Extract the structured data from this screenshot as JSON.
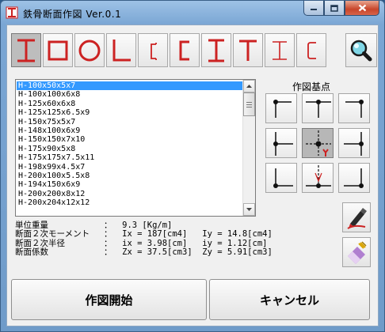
{
  "window": {
    "title": "鉄骨断面作図   Ver.0.1",
    "icon": "i-beam-app-icon",
    "controls": [
      "minimize",
      "maximize",
      "close"
    ]
  },
  "shape_toolbar": {
    "items": [
      {
        "name": "h-beam",
        "selected": true
      },
      {
        "name": "square-tube",
        "selected": false
      },
      {
        "name": "round-pipe",
        "selected": false
      },
      {
        "name": "angle",
        "selected": false
      },
      {
        "name": "light-channel",
        "selected": false
      },
      {
        "name": "lip-channel",
        "selected": false
      },
      {
        "name": "i-beam",
        "selected": false
      },
      {
        "name": "t-section",
        "selected": false
      },
      {
        "name": "i-beam-outline",
        "selected": false
      },
      {
        "name": "channel-rounded",
        "selected": false
      }
    ],
    "search_icon": "magnifier-icon",
    "accent_color": "#cc2222"
  },
  "section_list": {
    "selected_index": 0,
    "items": [
      "H-100x50x5x7",
      "H-100x100x6x8",
      "H-125x60x6x8",
      "H-125x125x6.5x9",
      "H-150x75x5x7",
      "H-148x100x6x9",
      "H-150x150x7x10",
      "H-175x90x5x8",
      "H-175x175x7.5x11",
      "H-198x99x4.5x7",
      "H-200x100x5.5x8",
      "H-194x150x6x9",
      "H-200x200x8x12",
      "H-200x204x12x12"
    ]
  },
  "base_point": {
    "label": "作図基点",
    "selected": "center",
    "marker": "Y"
  },
  "tools": {
    "pen_icon": "pen-icon",
    "eraser_icon": "eraser-icon"
  },
  "info": {
    "weight_label": "単位重量",
    "weight_value": "：  9.3 [Kg/m]",
    "moment_label": "断面２次モーメント",
    "moment_value": "：  Ix = 187[cm4]   Iy = 14.8[cm4]",
    "radius_label": "断面２次半径",
    "radius_value": "：  ix = 3.98[cm]   iy = 1.12[cm]",
    "modulus_label": "断面係数",
    "modulus_value": "：  Zx = 37.5[cm3]  Zy = 5.91[cm3]"
  },
  "buttons": {
    "start_label": "作図開始",
    "cancel_label": "キャンセル"
  }
}
